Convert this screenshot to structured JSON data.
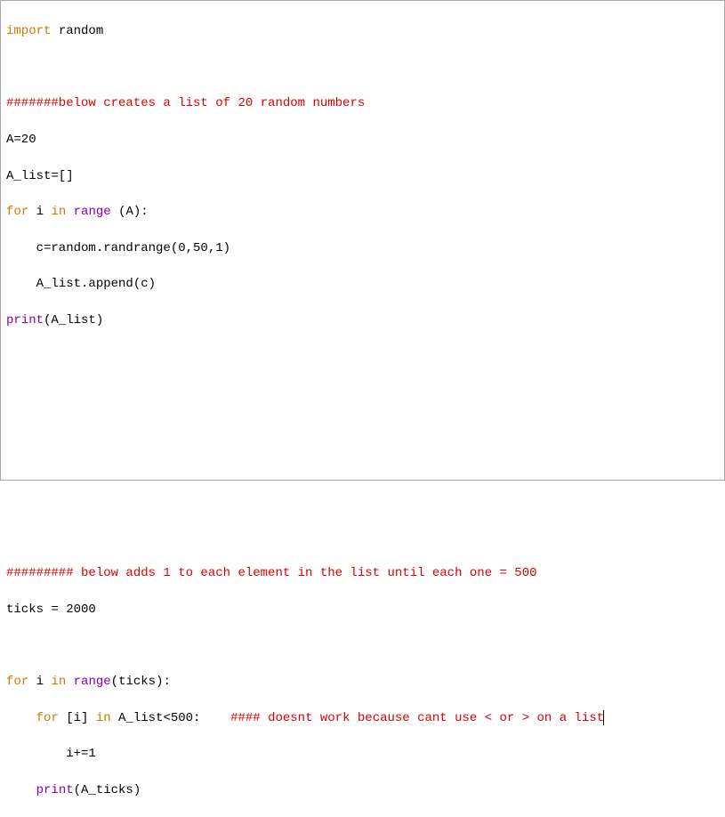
{
  "code": {
    "l1": {
      "import": "import",
      "random": "random"
    },
    "l3": {
      "comment": "#######below creates a list of 20 random numbers"
    },
    "l4": {
      "text": "A=20"
    },
    "l5": {
      "text": "A_list=[]"
    },
    "l6": {
      "for": "for",
      "i": " i ",
      "in": "in",
      "range": " range ",
      "rest": "(A):"
    },
    "l7": {
      "text": "    c=random.randrange(0,50,1)"
    },
    "l8": {
      "text": "    A_list.append(c)"
    },
    "l9": {
      "print": "print",
      "rest": "(A_list)"
    },
    "l16": {
      "comment": "######### below adds 1 to each element in the list until each one = 500"
    },
    "l17": {
      "text": "ticks = 2000"
    },
    "l19": {
      "for": "for",
      "i": " i ",
      "in": "in",
      "range": " range",
      "rest": "(ticks):"
    },
    "l20": {
      "for": "    for",
      "i": " [i] ",
      "in": "in",
      "mid": " A_list<500:    ",
      "comment": "#### doesnt work because cant use < or > on a list"
    },
    "l21": {
      "text": "        i+=1"
    },
    "l22": {
      "indent": "    ",
      "print": "print",
      "rest": "(A_ticks)"
    }
  }
}
